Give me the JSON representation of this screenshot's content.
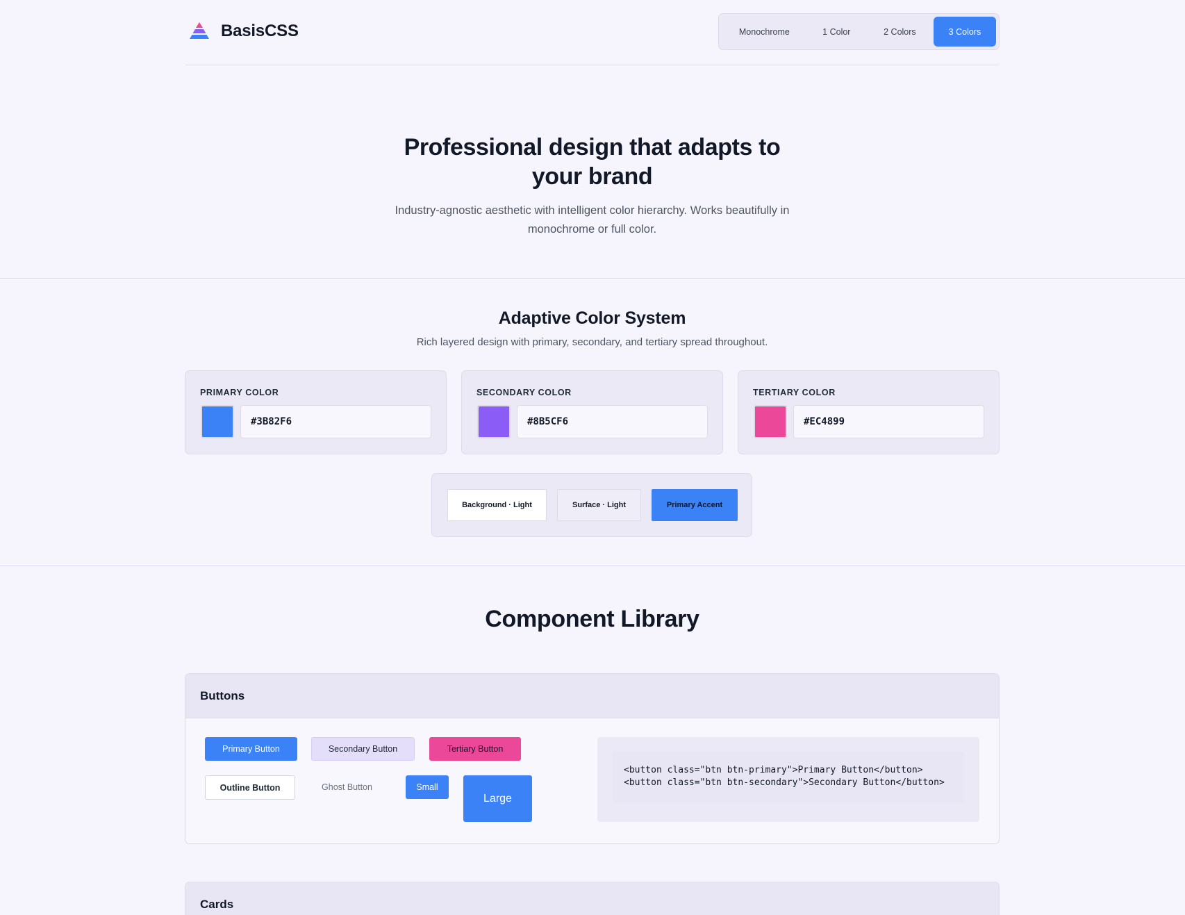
{
  "brand": {
    "name": "BasisCSS"
  },
  "mode_toggle": {
    "options": [
      "Monochrome",
      "1 Color",
      "2 Colors",
      "3 Colors"
    ],
    "active": "3 Colors"
  },
  "hero": {
    "title": "Professional design that adapts to your brand",
    "subtitle": "Industry-agnostic aesthetic with intelligent color hierarchy. Works beautifully in monochrome or full color."
  },
  "color_system": {
    "title": "Adaptive Color System",
    "subtitle": "Rich layered design with primary, secondary, and tertiary spread throughout.",
    "colors": [
      {
        "label": "PRIMARY COLOR",
        "value": "#3B82F6"
      },
      {
        "label": "SECONDARY COLOR",
        "value": "#8B5CF6"
      },
      {
        "label": "TERTIARY COLOR",
        "value": "#EC4899"
      }
    ],
    "preview": {
      "background": "Background · Light",
      "surface": "Surface · Light",
      "accent": "Primary Accent"
    }
  },
  "components": {
    "title": "Component Library",
    "buttons_panel": {
      "title": "Buttons",
      "primary": "Primary Button",
      "secondary": "Secondary Button",
      "tertiary": "Tertiary Button",
      "outline": "Outline Button",
      "ghost": "Ghost Button",
      "small": "Small",
      "large": "Large",
      "code": [
        "<button class=\"btn btn-primary\">Primary Button</button>",
        "<button class=\"btn btn-secondary\">Secondary Button</button>"
      ]
    },
    "cards_panel": {
      "title": "Cards"
    }
  },
  "theme": {
    "primary": "#3b82f6",
    "secondary": "#8b5cf6",
    "tertiary": "#ec4899",
    "background": "#f6f4fc",
    "surface": "#ebe9f5"
  }
}
